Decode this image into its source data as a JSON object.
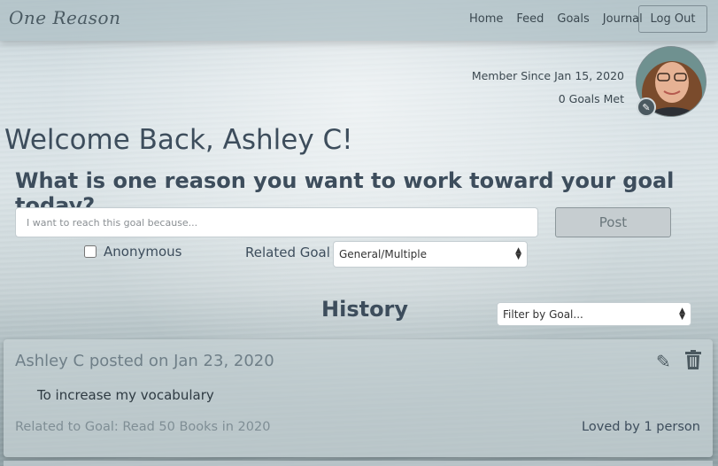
{
  "app": {
    "brand": "One Reason"
  },
  "nav": {
    "links": [
      "Home",
      "Feed",
      "Goals",
      "Journal"
    ],
    "logout_label": "Log Out"
  },
  "profile": {
    "member_since": "Member Since Jan 15, 2020",
    "goals_met": "0 Goals Met"
  },
  "welcome": "Welcome Back, Ashley C!",
  "form": {
    "question": "What is one reason you want to work toward your goal today?",
    "reason_placeholder": "I want to reach this goal because...",
    "reason_value": "",
    "post_label": "Post",
    "anonymous_label": "Anonymous",
    "related_goal_label": "Related Goal",
    "related_goal_selected": "General/Multiple"
  },
  "history": {
    "title": "History",
    "filter_selected": "Filter by Goal...",
    "posts": [
      {
        "header": "Ashley C posted on Jan 23, 2020",
        "body": "To increase my vocabulary",
        "related": "Related to Goal: Read 50 Books in 2020",
        "loved": "Loved by 1 person"
      }
    ]
  },
  "colors": {
    "text": "#3d4d5c",
    "muted": "#7f8e95",
    "card": "#c8d2d5"
  },
  "icons": [
    "pencil-icon",
    "trash-icon",
    "chevron-updown-icon"
  ]
}
